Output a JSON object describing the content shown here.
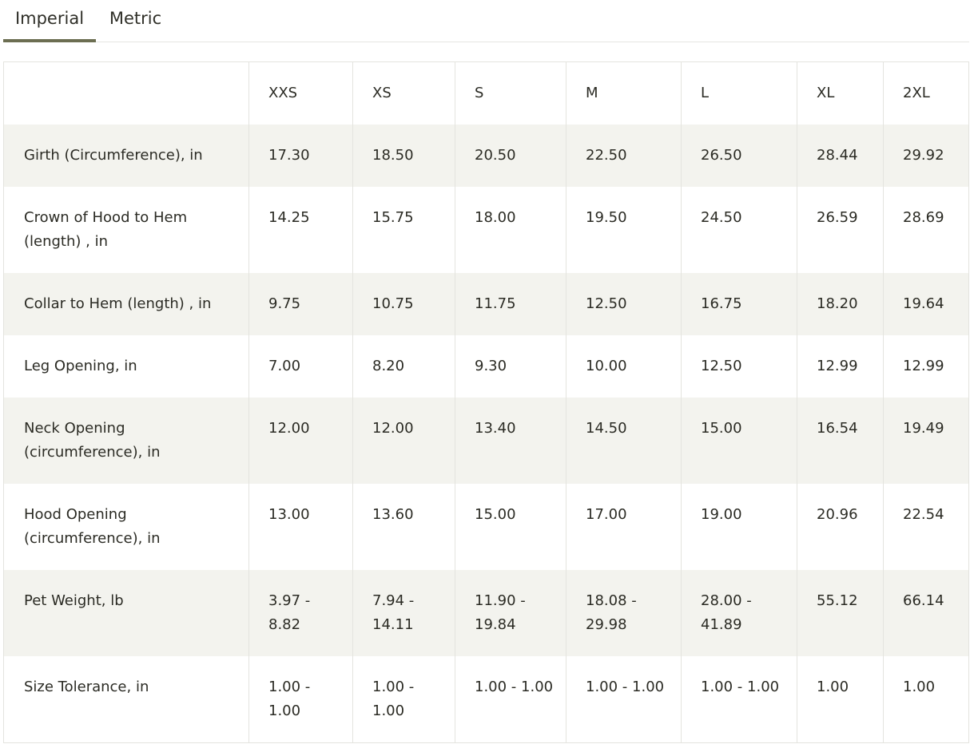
{
  "tabs": [
    {
      "label": "Imperial",
      "active": true
    },
    {
      "label": "Metric",
      "active": false
    }
  ],
  "table": {
    "headers": [
      "",
      "XXS",
      "XS",
      "S",
      "M",
      "L",
      "XL",
      "2XL"
    ],
    "rows": [
      {
        "label": "Girth (Circumference), in",
        "values": [
          "17.30",
          "18.50",
          "20.50",
          "22.50",
          "26.50",
          "28.44",
          "29.92"
        ]
      },
      {
        "label": "Crown of Hood to Hem (length) , in",
        "values": [
          "14.25",
          "15.75",
          "18.00",
          "19.50",
          "24.50",
          "26.59",
          "28.69"
        ]
      },
      {
        "label": "Collar to Hem (length) , in",
        "values": [
          "9.75",
          "10.75",
          "11.75",
          "12.50",
          "16.75",
          "18.20",
          "19.64"
        ]
      },
      {
        "label": "Leg Opening, in",
        "values": [
          "7.00",
          "8.20",
          "9.30",
          "10.00",
          "12.50",
          "12.99",
          "12.99"
        ]
      },
      {
        "label": "Neck Opening (circumference), in",
        "values": [
          "12.00",
          "12.00",
          "13.40",
          "14.50",
          "15.00",
          "16.54",
          "19.49"
        ]
      },
      {
        "label": "Hood Opening (circumference), in",
        "values": [
          "13.00",
          "13.60",
          "15.00",
          "17.00",
          "19.00",
          "20.96",
          "22.54"
        ]
      },
      {
        "label": "Pet Weight, lb",
        "values": [
          "3.97 - 8.82",
          "7.94 - 14.11",
          "11.90 - 19.84",
          "18.08 - 29.98",
          "28.00 - 41.89",
          "55.12",
          "66.14"
        ]
      },
      {
        "label": "Size Tolerance, in",
        "values": [
          "1.00 - 1.00",
          "1.00 - 1.00",
          "1.00 - 1.00",
          "1.00 - 1.00",
          "1.00 - 1.00",
          "1.00",
          "1.00"
        ]
      }
    ]
  },
  "colors": {
    "accent": "#6c6e52",
    "row_shade": "#f3f3ee",
    "border": "#e4e4df",
    "text": "#2b2b24"
  }
}
